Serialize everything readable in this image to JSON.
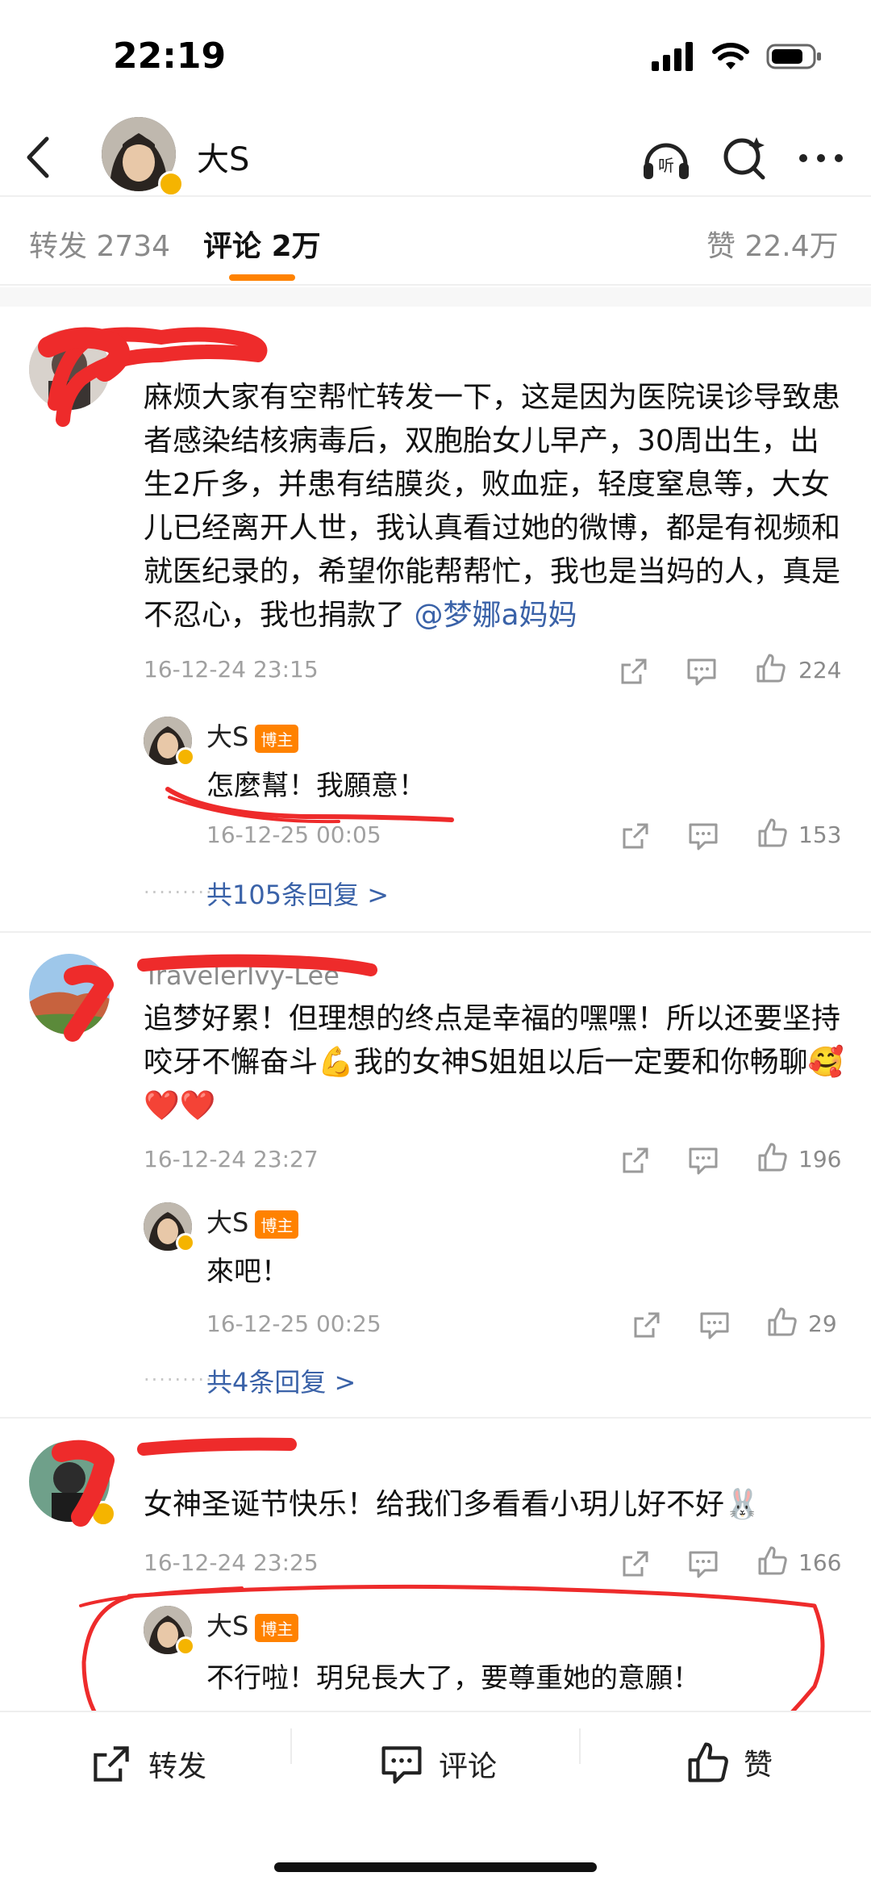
{
  "status_bar": {
    "time": "22:19"
  },
  "header": {
    "name": "大S"
  },
  "tabs": {
    "repost_label": "转发",
    "repost_count": "2734",
    "comment_label": "评论",
    "comment_count": "2万",
    "like_label": "赞",
    "like_count": "22.4万"
  },
  "comments": [
    {
      "text_before": "麻烦大家有空帮忙转发一下，这是因为医院误诊导致患者感染结核病毒后，双胞胎女儿早产，30周出生，出生2斤多，并患有结膜炎，败血症，轻度窒息等，大女儿已经离开人世，我认真看过她的微博，都是有视频和就医纪录的，希望你能帮帮忙，我也是当妈的人，真是不忍心，我也捐款了",
      "mention": "@梦娜a妈妈",
      "time": "16-12-24 23:15",
      "likes": "224",
      "reply": {
        "name": "大S",
        "badge": "博主",
        "text": "怎麼幫！我願意！",
        "time": "16-12-25 00:05",
        "likes": "153"
      },
      "more_replies": "共105条回复 >"
    },
    {
      "username": "TravelerIvy-Lee",
      "text": "追梦好累！但理想的终点是幸福的嘿嘿！所以还要坚持咬牙不懈奋斗💪我的女神S姐姐以后一定要和你畅聊🥰❤️❤️",
      "time": "16-12-24 23:27",
      "likes": "196",
      "reply": {
        "name": "大S",
        "badge": "博主",
        "text": "來吧！",
        "time": "16-12-25 00:25",
        "likes": "29"
      },
      "more_replies": "共4条回复 >"
    },
    {
      "text": "女神圣诞节快乐！给我们多看看小玥儿好不好🐰",
      "time": "16-12-24 23:25",
      "likes": "166",
      "reply": {
        "name": "大S",
        "badge": "博主",
        "text": "不行啦！玥兒長大了，要尊重她的意願！"
      }
    }
  ],
  "bottom_bar": {
    "repost": "转发",
    "comment": "评论",
    "like": "赞"
  },
  "colors": {
    "accent": "#ff8200",
    "link": "#3a62a8",
    "scribble": "#ee2b2b"
  }
}
